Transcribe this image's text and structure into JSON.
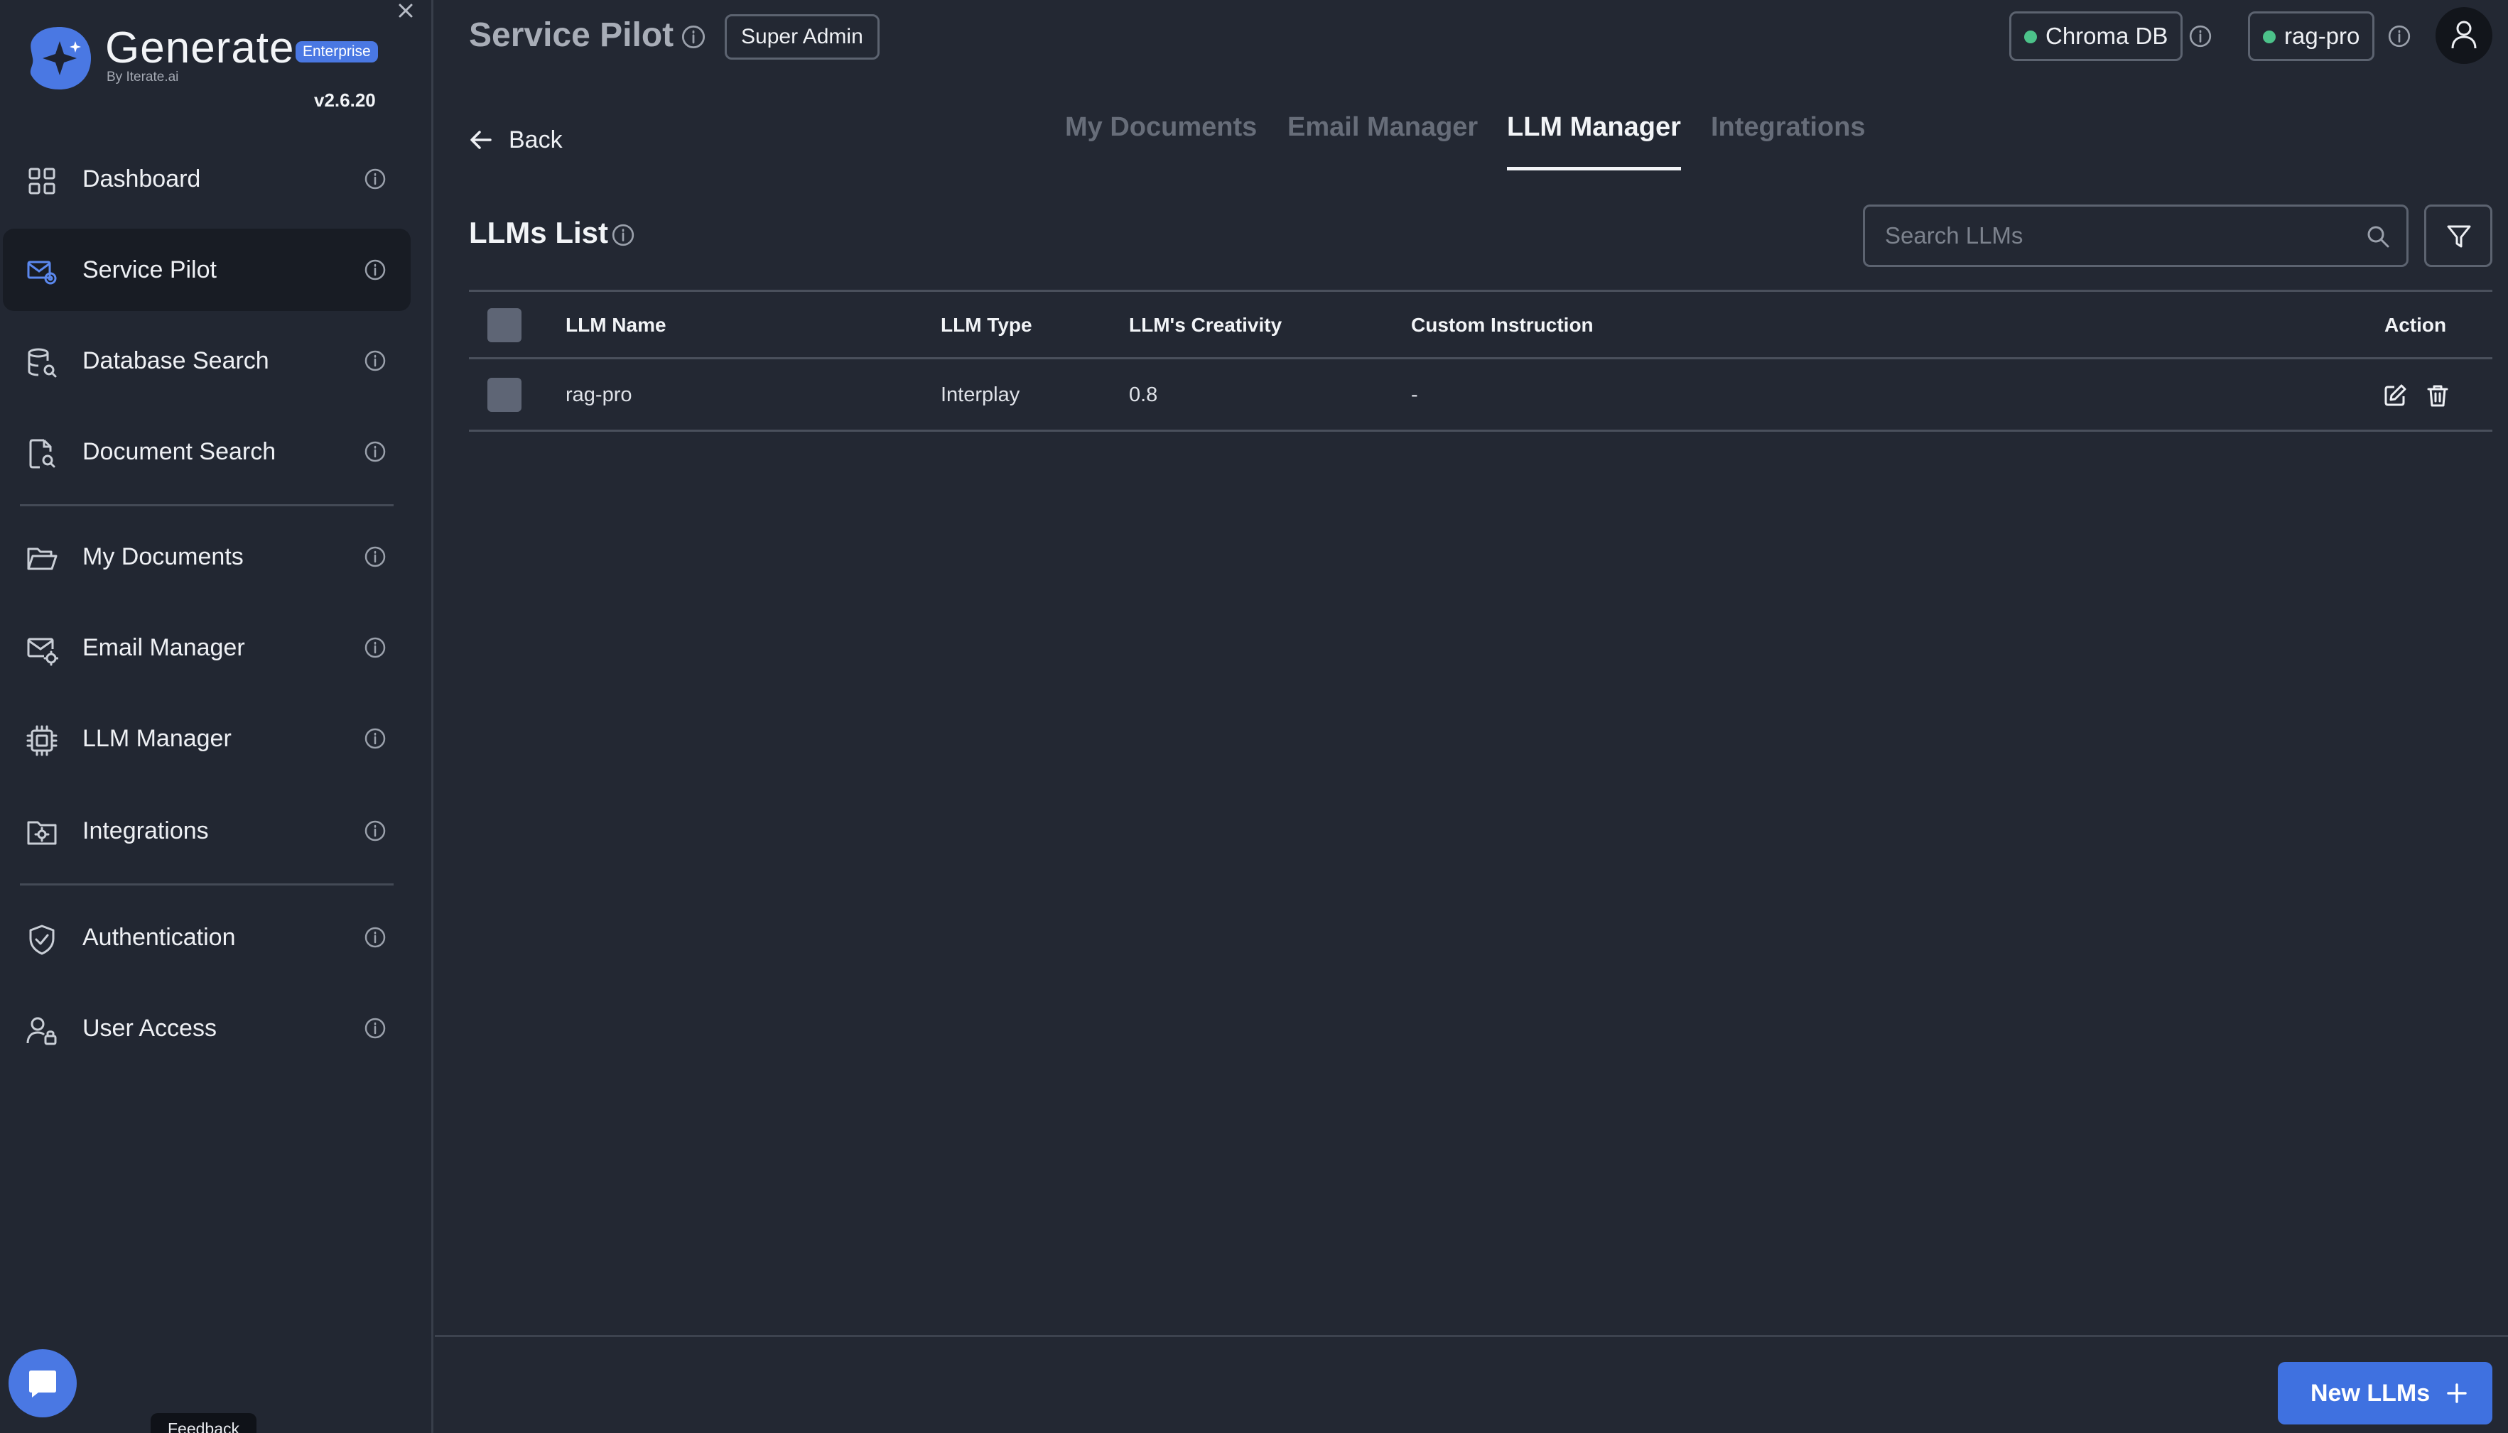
{
  "brand": {
    "name": "Generate",
    "badge": "Enterprise",
    "by": "By Iterate.ai",
    "version": "v2.6.20"
  },
  "sidebar": {
    "items": [
      {
        "label": "Dashboard",
        "icon": "grid-icon"
      },
      {
        "label": "Service Pilot",
        "icon": "mail-tools-icon",
        "active": true
      },
      {
        "label": "Database Search",
        "icon": "database-search-icon"
      },
      {
        "label": "Document Search",
        "icon": "document-search-icon"
      },
      {
        "label": "My Documents",
        "icon": "folder-open-icon"
      },
      {
        "label": "Email Manager",
        "icon": "mail-gear-icon"
      },
      {
        "label": "LLM Manager",
        "icon": "chip-icon"
      },
      {
        "label": "Integrations",
        "icon": "folder-gear-icon"
      },
      {
        "label": "Authentication",
        "icon": "shield-check-icon"
      },
      {
        "label": "User Access",
        "icon": "user-lock-icon"
      }
    ],
    "feedback": "Feedback"
  },
  "header": {
    "title": "Service Pilot",
    "role": "Super Admin",
    "db_status": "Chroma DB",
    "model_status": "rag-pro"
  },
  "nav": {
    "back": "Back",
    "tabs": [
      {
        "label": "My Documents"
      },
      {
        "label": "Email Manager"
      },
      {
        "label": "LLM Manager",
        "active": true
      },
      {
        "label": "Integrations"
      }
    ]
  },
  "list": {
    "title": "LLMs List",
    "search_placeholder": "Search LLMs",
    "columns": {
      "name": "LLM Name",
      "type": "LLM Type",
      "creativity": "LLM's Creativity",
      "instruction": "Custom Instruction",
      "action": "Action"
    },
    "rows": [
      {
        "name": "rag-pro",
        "type": "Interplay",
        "creativity": "0.8",
        "instruction": "-"
      }
    ]
  },
  "footer": {
    "new_button": "New LLMs"
  },
  "colors": {
    "background": "#232833",
    "accent": "#3f71e0",
    "status_online": "#4cc28a"
  }
}
